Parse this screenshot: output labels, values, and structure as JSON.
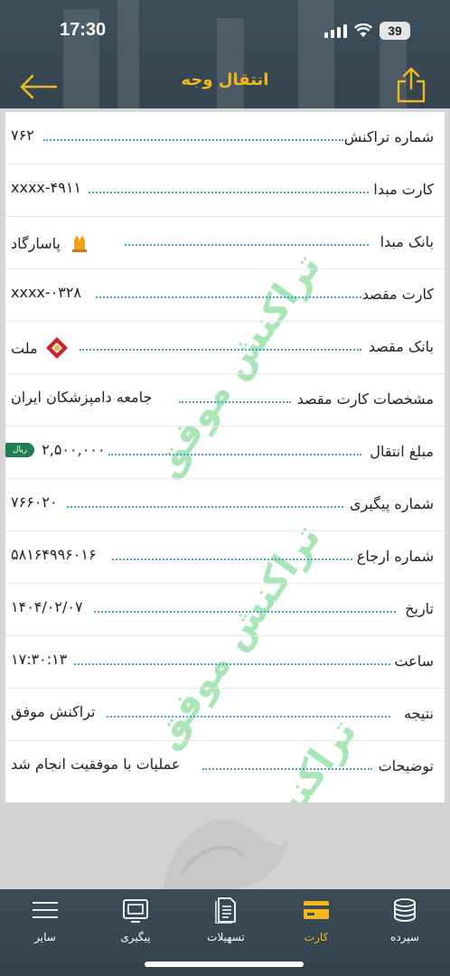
{
  "status_bar": {
    "time": "17:30",
    "battery": "39"
  },
  "header": {
    "title": "انتقال وجه"
  },
  "watermark_text": "تراکنش موفق",
  "rows": [
    {
      "label": "شماره تراکنش",
      "value": "۷۶۲"
    },
    {
      "label": "کارت مبدا",
      "value": "xxxx-۴۹۱۱"
    },
    {
      "label": "بانک مبدا",
      "value": "پاسارگاد"
    },
    {
      "label": "کارت مقصد",
      "value": "xxxx-۰۳۲۸"
    },
    {
      "label": "بانک مقصد",
      "value": "ملت"
    },
    {
      "label": "مشخصات کارت مقصد",
      "value": "جامعه دامپزشکان ایران"
    },
    {
      "label": "مبلغ انتقال",
      "value": "۲,۵۰۰,۰۰۰",
      "badge": "ریال"
    },
    {
      "label": "شماره پیگیری",
      "value": "۷۶۶۰۲۰"
    },
    {
      "label": "شماره ارجاع",
      "value": "۵۸۱۶۴۹۹۶۰۱۶"
    },
    {
      "label": "تاریخ",
      "value": "۱۴۰۴/۰۲/۰۷"
    },
    {
      "label": "ساعت",
      "value": "۱۷:۳۰:۱۳"
    },
    {
      "label": "نتیجه",
      "value": "تراکنش موفق"
    },
    {
      "label": "توضیحات",
      "value": "عملیات با موفقیت انجام شد"
    }
  ],
  "nav": [
    {
      "label": "سپرده",
      "icon": "coins-icon"
    },
    {
      "label": "کارت",
      "icon": "card-icon",
      "active": true
    },
    {
      "label": "تسهیلات",
      "icon": "document-icon"
    },
    {
      "label": "پیگیری",
      "icon": "tracking-icon"
    },
    {
      "label": "سایر",
      "icon": "menu-icon"
    }
  ],
  "colors": {
    "accent": "#f2b81b",
    "header": "#3c4e5a",
    "watermark": "#63d37a",
    "dots": "#4aa3c9",
    "rial_badge": "#1f7d4f"
  }
}
